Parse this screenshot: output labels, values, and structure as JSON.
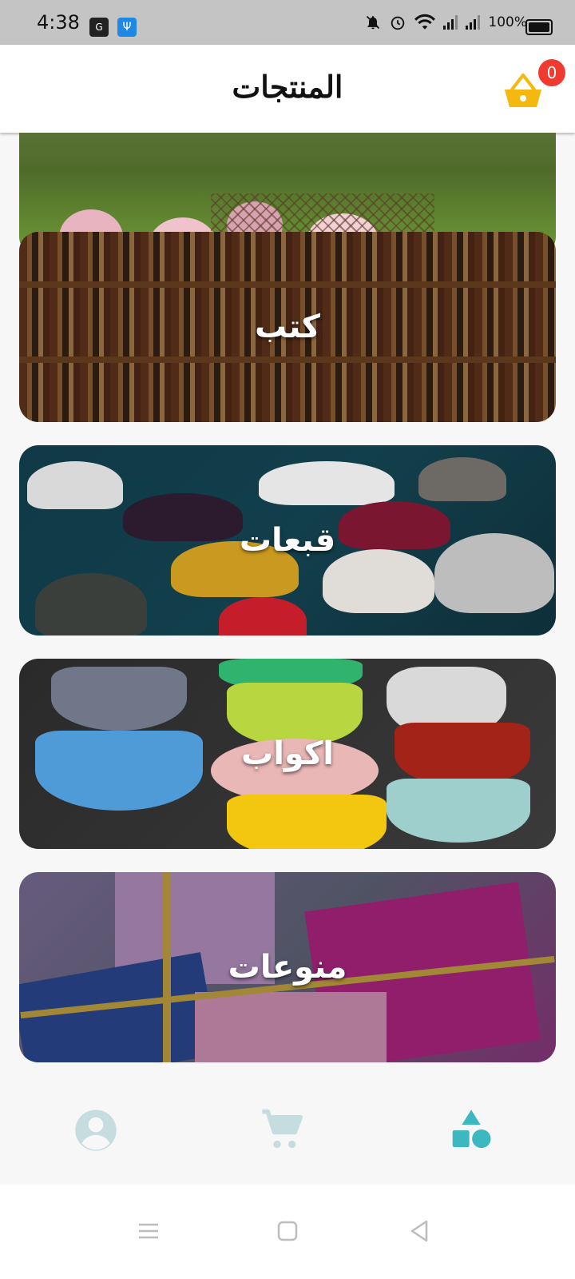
{
  "status_bar": {
    "time": "4:38",
    "battery": "100%",
    "icons": [
      "translate-icon",
      "usb-icon",
      "bell-off-icon",
      "alarm-icon",
      "wifi-icon",
      "signal-icon",
      "signal-icon",
      "battery-icon"
    ]
  },
  "header": {
    "title": "المنتجات",
    "cart_count": "0",
    "cart_icon": "basket-icon"
  },
  "categories": [
    {
      "label": "",
      "image": "flowers"
    },
    {
      "label": "كتب",
      "image": "books"
    },
    {
      "label": "قبعات",
      "image": "hats"
    },
    {
      "label": "اكواب",
      "image": "cups"
    },
    {
      "label": "منوعات",
      "image": "gifts"
    }
  ],
  "bottom_nav": {
    "items": [
      {
        "icon": "account-icon",
        "active": false
      },
      {
        "icon": "cart-icon",
        "active": false
      },
      {
        "icon": "shapes-icon",
        "active": true
      }
    ],
    "inactive_color": "#c6dde0",
    "active_color": "#3cb8c0"
  },
  "colors": {
    "badge": "#ef3b2f",
    "basket": "#f5b80f"
  }
}
